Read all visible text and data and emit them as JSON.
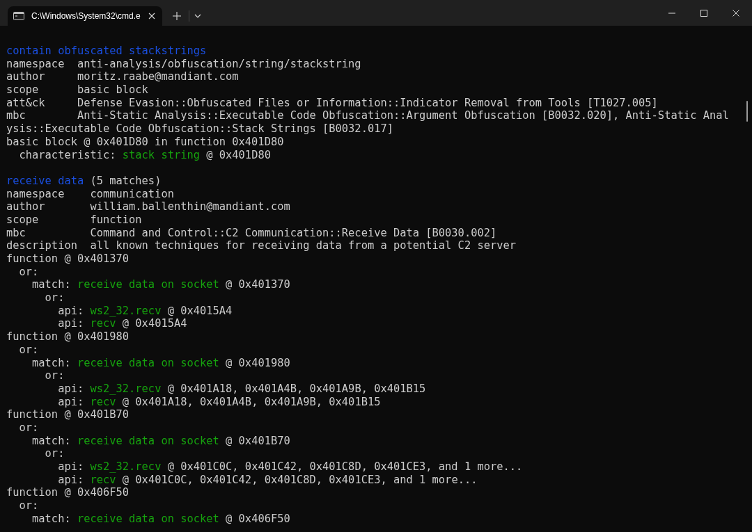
{
  "window": {
    "tab_title": "C:\\Windows\\System32\\cmd.e",
    "tab_selected": true
  },
  "blocks": [
    {
      "lines": [
        [
          {
            "text": "contain obfuscated stackstrings",
            "kind": "rule"
          }
        ],
        [
          {
            "text": "namespace  anti-analysis/obfuscation/string/stackstring",
            "kind": "plain"
          }
        ],
        [
          {
            "text": "author     moritz.raabe@mandiant.com",
            "kind": "plain"
          }
        ],
        [
          {
            "text": "scope      basic block",
            "kind": "plain"
          }
        ],
        [
          {
            "text": "att&ck     Defense Evasion::Obfuscated Files or Information::Indicator Removal from Tools [T1027.005]",
            "kind": "plain"
          }
        ],
        [
          {
            "text": "mbc        Anti-Static Analysis::Executable Code Obfuscation::Argument Obfuscation [B0032.020], Anti-Static Anal",
            "kind": "plain"
          }
        ],
        [
          {
            "text": "ysis::Executable Code Obfuscation::Stack Strings [B0032.017]",
            "kind": "plain"
          }
        ],
        [
          {
            "text": "basic block @ 0x401D80 in function 0x401D80",
            "kind": "plain"
          }
        ],
        [
          {
            "text": "  characteristic: ",
            "kind": "plain"
          },
          {
            "text": "stack string",
            "kind": "match"
          },
          {
            "text": " @ 0x401D80",
            "kind": "plain"
          }
        ]
      ]
    },
    {
      "lines": [
        [
          {
            "text": "receive data",
            "kind": "rule"
          },
          {
            "text": " (5 matches)",
            "kind": "plain"
          }
        ],
        [
          {
            "text": "namespace    communication",
            "kind": "plain"
          }
        ],
        [
          {
            "text": "author       william.ballenthin@mandiant.com",
            "kind": "plain"
          }
        ],
        [
          {
            "text": "scope        function",
            "kind": "plain"
          }
        ],
        [
          {
            "text": "mbc          Command and Control::C2 Communication::Receive Data [B0030.002]",
            "kind": "plain"
          }
        ],
        [
          {
            "text": "description  all known techniques for receiving data from a potential C2 server",
            "kind": "plain"
          }
        ],
        [
          {
            "text": "function @ 0x401370",
            "kind": "plain"
          }
        ],
        [
          {
            "text": "  or:",
            "kind": "plain"
          }
        ],
        [
          {
            "text": "    match: ",
            "kind": "plain"
          },
          {
            "text": "receive data on socket",
            "kind": "match"
          },
          {
            "text": " @ 0x401370",
            "kind": "plain"
          }
        ],
        [
          {
            "text": "      or:",
            "kind": "plain"
          }
        ],
        [
          {
            "text": "        api: ",
            "kind": "plain"
          },
          {
            "text": "ws2_32.recv",
            "kind": "match"
          },
          {
            "text": " @ 0x4015A4",
            "kind": "plain"
          }
        ],
        [
          {
            "text": "        api: ",
            "kind": "plain"
          },
          {
            "text": "recv",
            "kind": "match"
          },
          {
            "text": " @ 0x4015A4",
            "kind": "plain"
          }
        ],
        [
          {
            "text": "function @ 0x401980",
            "kind": "plain"
          }
        ],
        [
          {
            "text": "  or:",
            "kind": "plain"
          }
        ],
        [
          {
            "text": "    match: ",
            "kind": "plain"
          },
          {
            "text": "receive data on socket",
            "kind": "match"
          },
          {
            "text": " @ 0x401980",
            "kind": "plain"
          }
        ],
        [
          {
            "text": "      or:",
            "kind": "plain"
          }
        ],
        [
          {
            "text": "        api: ",
            "kind": "plain"
          },
          {
            "text": "ws2_32.recv",
            "kind": "match"
          },
          {
            "text": " @ 0x401A18, 0x401A4B, 0x401A9B, 0x401B15",
            "kind": "plain"
          }
        ],
        [
          {
            "text": "        api: ",
            "kind": "plain"
          },
          {
            "text": "recv",
            "kind": "match"
          },
          {
            "text": " @ 0x401A18, 0x401A4B, 0x401A9B, 0x401B15",
            "kind": "plain"
          }
        ],
        [
          {
            "text": "function @ 0x401B70",
            "kind": "plain"
          }
        ],
        [
          {
            "text": "  or:",
            "kind": "plain"
          }
        ],
        [
          {
            "text": "    match: ",
            "kind": "plain"
          },
          {
            "text": "receive data on socket",
            "kind": "match"
          },
          {
            "text": " @ 0x401B70",
            "kind": "plain"
          }
        ],
        [
          {
            "text": "      or:",
            "kind": "plain"
          }
        ],
        [
          {
            "text": "        api: ",
            "kind": "plain"
          },
          {
            "text": "ws2_32.recv",
            "kind": "match"
          },
          {
            "text": " @ 0x401C0C, 0x401C42, 0x401C8D, 0x401CE3, and 1 more...",
            "kind": "plain"
          }
        ],
        [
          {
            "text": "        api: ",
            "kind": "plain"
          },
          {
            "text": "recv",
            "kind": "match"
          },
          {
            "text": " @ 0x401C0C, 0x401C42, 0x401C8D, 0x401CE3, and 1 more...",
            "kind": "plain"
          }
        ],
        [
          {
            "text": "function @ 0x406F50",
            "kind": "plain"
          }
        ],
        [
          {
            "text": "  or:",
            "kind": "plain"
          }
        ],
        [
          {
            "text": "    match: ",
            "kind": "plain"
          },
          {
            "text": "receive data on socket",
            "kind": "match"
          },
          {
            "text": " @ 0x406F50",
            "kind": "plain"
          }
        ]
      ]
    }
  ]
}
